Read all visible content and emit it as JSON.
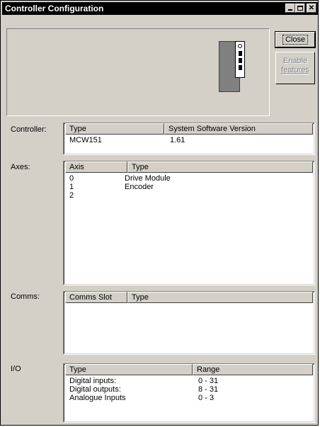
{
  "window": {
    "title": "Controller Configuration"
  },
  "buttons": {
    "close": "Close",
    "enable_line1": "Enable",
    "enable_line2": "features"
  },
  "controller": {
    "label": "Controller:",
    "columns": [
      "Type",
      "System Software Version"
    ],
    "rows": [
      [
        "MCW151",
        "1.61"
      ]
    ]
  },
  "axes": {
    "label": "Axes:",
    "columns": [
      "Axis",
      "Type"
    ],
    "rows": [
      [
        "0",
        "Drive Module"
      ],
      [
        "1",
        "Encoder"
      ],
      [
        "2",
        ""
      ]
    ]
  },
  "comms": {
    "label": "Comms:",
    "columns": [
      "Comms Slot",
      "Type"
    ],
    "rows": []
  },
  "io": {
    "label": "I/O",
    "columns": [
      "Type",
      "Range"
    ],
    "rows": [
      [
        "Digital inputs:",
        "0 - 31"
      ],
      [
        "Digital outputs:",
        "8 - 31"
      ],
      [
        "Analogue Inputs",
        "0 - 3"
      ]
    ]
  }
}
